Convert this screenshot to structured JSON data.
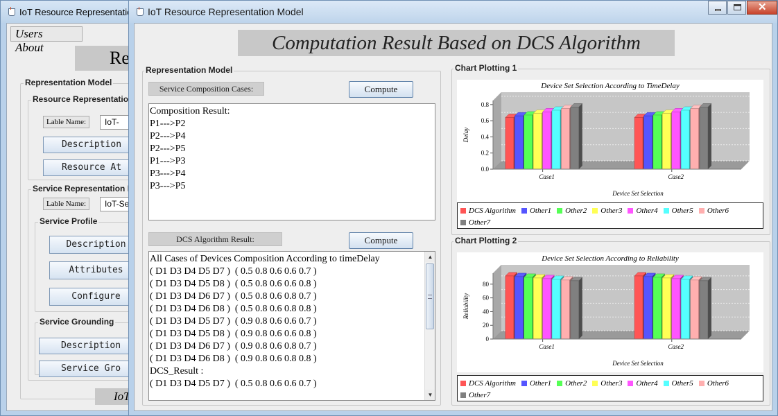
{
  "background_window": {
    "title": "IoT Resource Representation",
    "menu": [
      "Users",
      "About"
    ],
    "heading_fragment": "Re",
    "representation_group": "Representation Model",
    "resource_group": "Resource Representation",
    "resource_label_name": "Lable Name:",
    "resource_label_value": "IoT-",
    "resource_buttons": [
      "Description",
      "Resource At"
    ],
    "service_group": "Service Representation M",
    "service_label_name": "Lable Name:",
    "service_label_value": "IoT-Se",
    "profile_group": "Service Profile",
    "profile_buttons": [
      "Description",
      "Attributes",
      "Configure"
    ],
    "grounding_group": "Service Grounding",
    "grounding_buttons": [
      "Description",
      "Service Gro"
    ],
    "footer_fragment": "IoT"
  },
  "main_window": {
    "title": "IoT Resource Representation Model",
    "page_title": "Computation Result Based on DCS Algorithm",
    "left_group": {
      "title": "Representation Model",
      "service_cases_label": "Service Composition Cases:",
      "compute_label_1": "Compute",
      "composition_lines": [
        "Composition Result:",
        "P1--->P2",
        "P2--->P4",
        "P2--->P5",
        "P1--->P3",
        "P3--->P4",
        "P3--->P5"
      ],
      "dcs_label": "DCS Algorithm Result:",
      "compute_label_2": "Compute",
      "dcs_lines": [
        "All Cases of Devices Composition According to timeDelay",
        "( D1 D3 D4 D5 D7 )  ( 0.5 0.8 0.6 0.6 0.7 )",
        "( D1 D3 D4 D5 D8 )  ( 0.5 0.8 0.6 0.6 0.8 )",
        "( D1 D3 D4 D6 D7 )  ( 0.5 0.8 0.6 0.8 0.7 )",
        "( D1 D3 D4 D6 D8 )  ( 0.5 0.8 0.6 0.8 0.8 )",
        "( D1 D3 D4 D5 D7 )  ( 0.9 0.8 0.6 0.6 0.7 )",
        "( D1 D3 D4 D5 D8 )  ( 0.9 0.8 0.6 0.6 0.8 )",
        "( D1 D3 D4 D6 D7 )  ( 0.9 0.8 0.6 0.8 0.7 )",
        "( D1 D3 D4 D6 D8 )  ( 0.9 0.8 0.6 0.8 0.8 )",
        "DCS_Result :",
        "( D1 D3 D4 D5 D7 )  ( 0.5 0.8 0.6 0.6 0.7 )"
      ]
    },
    "chart1_group": "Chart Plotting 1",
    "chart2_group": "Chart Plotting 2"
  },
  "chart_data": [
    {
      "type": "bar",
      "title": "Device Set Selection According to TimeDelay",
      "xlabel": "Device Set Selection",
      "ylabel": "Delay",
      "categories": [
        "Case1",
        "Case2"
      ],
      "yticks": [
        "0.0",
        "0.2",
        "0.4",
        "0.6",
        "0.8"
      ],
      "ylim": [
        0,
        0.85
      ],
      "series": [
        {
          "name": "DCS Algorithm",
          "color": "#ff5555",
          "values": [
            0.64,
            0.64
          ]
        },
        {
          "name": "Other1",
          "color": "#5555ff",
          "values": [
            0.66,
            0.66
          ]
        },
        {
          "name": "Other2",
          "color": "#55ff55",
          "values": [
            0.67,
            0.67
          ]
        },
        {
          "name": "Other3",
          "color": "#ffff55",
          "values": [
            0.69,
            0.69
          ]
        },
        {
          "name": "Other4",
          "color": "#ff55ff",
          "values": [
            0.71,
            0.71
          ]
        },
        {
          "name": "Other5",
          "color": "#55ffff",
          "values": [
            0.73,
            0.73
          ]
        },
        {
          "name": "Other6",
          "color": "#ffafaf",
          "values": [
            0.75,
            0.75
          ]
        },
        {
          "name": "Other7",
          "color": "#808080",
          "values": [
            0.77,
            0.77
          ]
        }
      ],
      "grid": true,
      "legend": "bottom"
    },
    {
      "type": "bar",
      "title": "Device Set Selection According to Reliability",
      "xlabel": "Device Set Selection",
      "ylabel": "Reliability",
      "categories": [
        "Case1",
        "Case2"
      ],
      "yticks": [
        "0",
        "20",
        "40",
        "60",
        "80"
      ],
      "ylim": [
        0,
        96
      ],
      "series": [
        {
          "name": "DCS Algorithm",
          "color": "#ff5555",
          "values": [
            92,
            92
          ]
        },
        {
          "name": "Other1",
          "color": "#5555ff",
          "values": [
            91,
            91
          ]
        },
        {
          "name": "Other2",
          "color": "#55ff55",
          "values": [
            90,
            90
          ]
        },
        {
          "name": "Other3",
          "color": "#ffff55",
          "values": [
            89,
            89
          ]
        },
        {
          "name": "Other4",
          "color": "#ff55ff",
          "values": [
            88,
            88
          ]
        },
        {
          "name": "Other5",
          "color": "#55ffff",
          "values": [
            87,
            87
          ]
        },
        {
          "name": "Other6",
          "color": "#ffafaf",
          "values": [
            86,
            86
          ]
        },
        {
          "name": "Other7",
          "color": "#808080",
          "values": [
            85,
            85
          ]
        }
      ],
      "grid": true,
      "legend": "bottom"
    }
  ]
}
